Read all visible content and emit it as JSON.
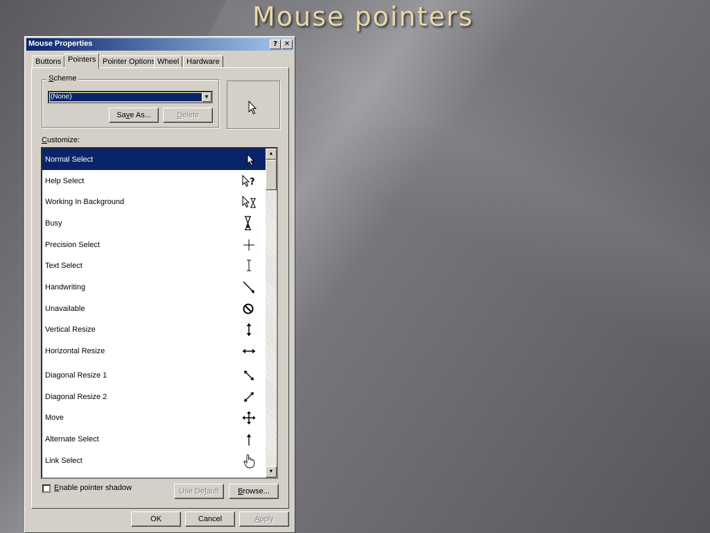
{
  "slide": {
    "title": "Mouse pointers"
  },
  "dialog": {
    "title": "Mouse Properties",
    "help_button": "?",
    "close_button": "✕",
    "tabs": [
      {
        "label": "Buttons",
        "active": false
      },
      {
        "label": "Pointers",
        "active": true
      },
      {
        "label": "Pointer Options",
        "active": false
      },
      {
        "label": "Wheel",
        "active": false
      },
      {
        "label": "Hardware",
        "active": false
      }
    ],
    "scheme": {
      "label_prefix": "",
      "label_accel": "S",
      "label_rest": "cheme",
      "selected_value": "(None)",
      "save_as": {
        "pre": "Sa",
        "accel": "v",
        "post": "e As..."
      },
      "delete": {
        "pre": "",
        "accel": "D",
        "post": "elete"
      }
    },
    "customize_label": {
      "accel": "C",
      "rest": "ustomize:"
    },
    "pointers": [
      {
        "label": "Normal Select",
        "icon": "arrow-icon",
        "selected": true
      },
      {
        "label": "Help Select",
        "icon": "help-select-icon"
      },
      {
        "label": "Working In Background",
        "icon": "working-background-icon"
      },
      {
        "label": "Busy",
        "icon": "hourglass-icon"
      },
      {
        "label": "Precision Select",
        "icon": "crosshair-icon"
      },
      {
        "label": "Text Select",
        "icon": "ibeam-icon"
      },
      {
        "label": "Handwriting",
        "icon": "pen-icon"
      },
      {
        "label": "Unavailable",
        "icon": "unavailable-icon"
      },
      {
        "label": "Vertical Resize",
        "icon": "vertical-resize-icon"
      },
      {
        "label": "Horizontal Resize",
        "icon": "horizontal-resize-icon"
      },
      {
        "label": "Diagonal Resize 1",
        "icon": "diagonal-resize-1-icon"
      },
      {
        "label": "Diagonal Resize 2",
        "icon": "diagonal-resize-2-icon"
      },
      {
        "label": "Move",
        "icon": "move-icon"
      },
      {
        "label": "Alternate Select",
        "icon": "up-arrow-icon"
      },
      {
        "label": "Link Select",
        "icon": "hand-icon"
      }
    ],
    "shadow_checkbox": {
      "checked": false,
      "accel": "E",
      "rest": "nable pointer shadow"
    },
    "use_default": {
      "pre": "Use De",
      "accel": "f",
      "post": "ault"
    },
    "browse": {
      "pre": "",
      "accel": "B",
      "post": "rowse..."
    },
    "ok": "OK",
    "cancel": "Cancel",
    "apply": {
      "pre": "",
      "accel": "A",
      "post": "pply"
    }
  },
  "colors": {
    "title_gold": "#e8d9a8",
    "selection_blue": "#0a246a",
    "dialog_face": "#d4d0c8"
  }
}
